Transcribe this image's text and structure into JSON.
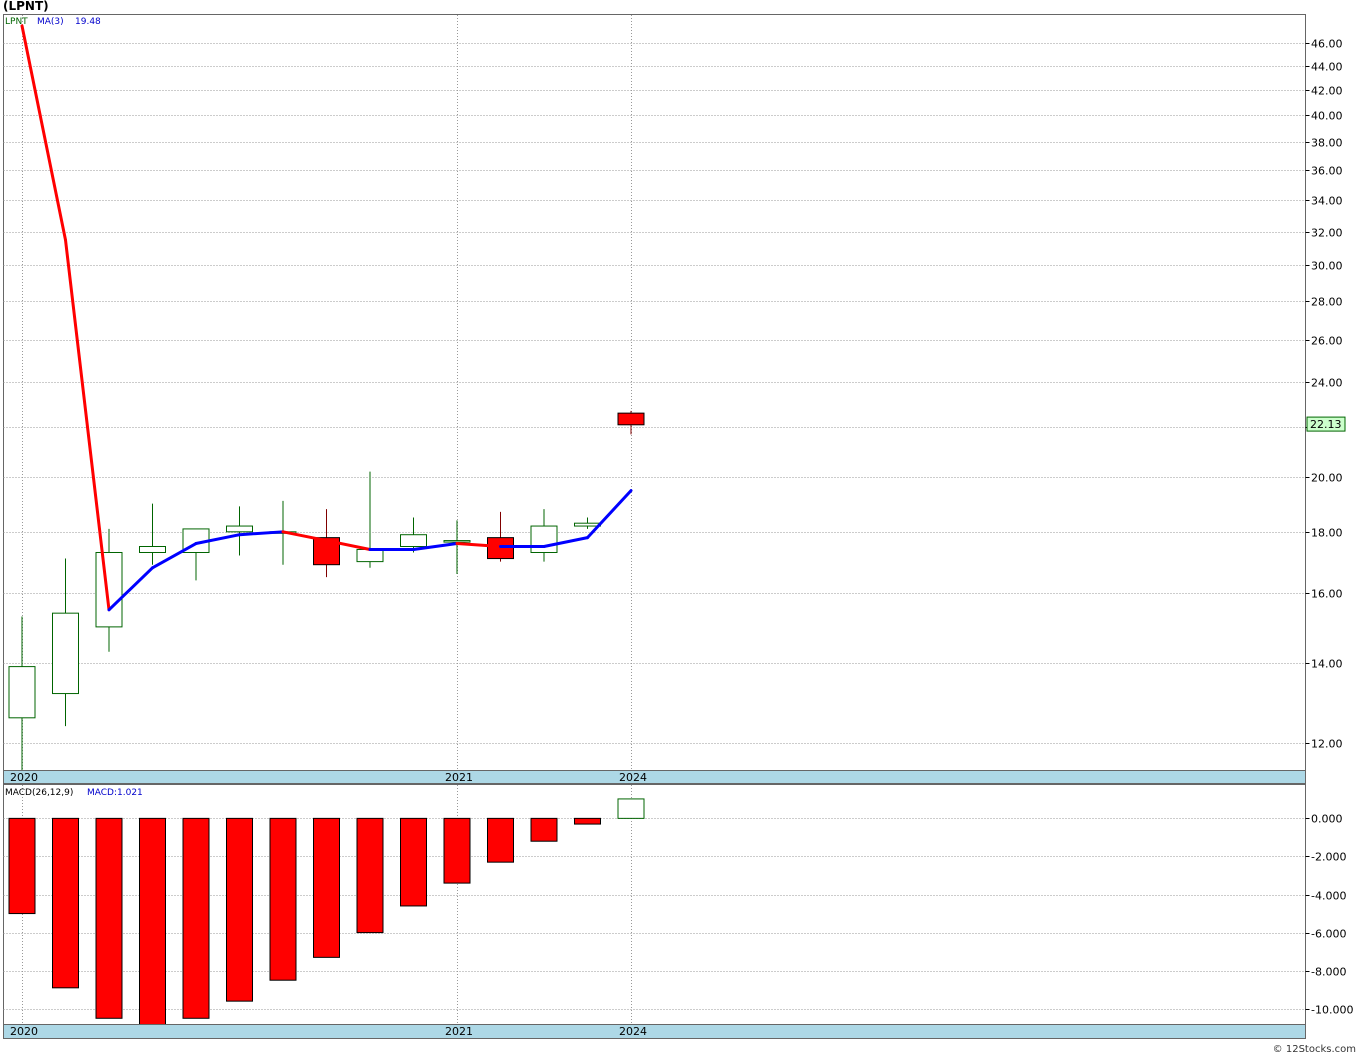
{
  "title": "(LPNT)",
  "footer": "© 12Stocks.com",
  "colors": {
    "up": "#006400",
    "down": "#ff0000",
    "ma_up": "#0000ff",
    "ma_down": "#ff0000",
    "grid": "#999999",
    "band": "#add8e6",
    "last_price_bg": "#ccffcc"
  },
  "chart_data": [
    {
      "type": "candlestick",
      "legend": {
        "symbol": "LPNT",
        "ma_label": "MA(3)",
        "ma_value": "19.48"
      },
      "y_scale": "log",
      "ylim": [
        11.4,
        48.4
      ],
      "y_ticks": [
        "12.00",
        "14.00",
        "16.00",
        "18.00",
        "20.00",
        "22.00",
        "24.00",
        "26.00",
        "28.00",
        "30.00",
        "32.00",
        "34.00",
        "36.00",
        "38.00",
        "40.00",
        "42.00",
        "44.00",
        "46.00"
      ],
      "x_labels": [
        {
          "index": 0,
          "label": "2020"
        },
        {
          "index": 10,
          "label": "2021"
        },
        {
          "index": 14,
          "label": "2024"
        }
      ],
      "last_price": "22.13",
      "candles": [
        {
          "open": 12.6,
          "high": 15.3,
          "low": 11.4,
          "close": 13.9
        },
        {
          "open": 13.2,
          "high": 17.1,
          "low": 12.4,
          "close": 15.4
        },
        {
          "open": 15.0,
          "high": 18.1,
          "low": 14.3,
          "close": 17.3
        },
        {
          "open": 17.3,
          "high": 19.0,
          "low": 16.9,
          "close": 17.5
        },
        {
          "open": 17.3,
          "high": 18.1,
          "low": 16.4,
          "close": 18.1
        },
        {
          "open": 18.0,
          "high": 18.9,
          "low": 17.2,
          "close": 18.2
        },
        {
          "open": 18.0,
          "high": 19.1,
          "low": 16.9,
          "close": 18.0
        },
        {
          "open": 17.8,
          "high": 18.8,
          "low": 16.5,
          "close": 16.9
        },
        {
          "open": 17.0,
          "high": 20.2,
          "low": 16.8,
          "close": 17.4
        },
        {
          "open": 17.5,
          "high": 18.5,
          "low": 17.3,
          "close": 17.9
        },
        {
          "open": 17.7,
          "high": 18.4,
          "low": 16.6,
          "close": 17.7
        },
        {
          "open": 17.8,
          "high": 18.7,
          "low": 17.0,
          "close": 17.1
        },
        {
          "open": 17.3,
          "high": 18.8,
          "low": 17.0,
          "close": 18.2
        },
        {
          "open": 18.2,
          "high": 18.5,
          "low": 18.1,
          "close": 18.3
        },
        {
          "open": 22.6,
          "high": 22.7,
          "low": 21.7,
          "close": 22.1
        }
      ],
      "ma": [
        47.5,
        31.5,
        15.5,
        16.8,
        17.6,
        17.9,
        18.0,
        17.7,
        17.4,
        17.4,
        17.6,
        17.5,
        17.5,
        17.8,
        19.48
      ]
    },
    {
      "type": "bar",
      "legend": {
        "label": "MACD(26,12,9)",
        "value_label": "MACD:1.021"
      },
      "ylim": [
        -10.8,
        1.7
      ],
      "y_ticks": [
        "0.000",
        "-2.000",
        "-4.000",
        "-6.000",
        "-8.000",
        "-10.000"
      ],
      "values": [
        -5.0,
        -8.9,
        -10.5,
        -10.9,
        -10.5,
        -9.6,
        -8.5,
        -7.3,
        -6.0,
        -4.6,
        -3.4,
        -2.3,
        -1.2,
        -0.3,
        1.021
      ]
    }
  ]
}
